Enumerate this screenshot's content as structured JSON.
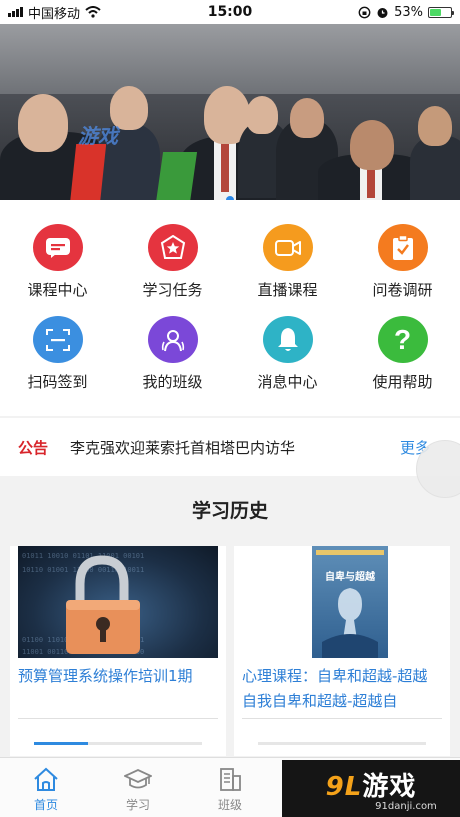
{
  "status_bar": {
    "carrier": "中国移动",
    "time": "15:00",
    "battery": "53%",
    "battery_level": 0.53
  },
  "banner": {
    "watermark": "游戏",
    "dot_color": "#2a88e8"
  },
  "menu": {
    "items": [
      {
        "label": "课程中心",
        "icon": "message-icon",
        "color": "#e5343f"
      },
      {
        "label": "学习任务",
        "icon": "star-badge-icon",
        "color": "#e5343f"
      },
      {
        "label": "直播课程",
        "icon": "video-camera-icon",
        "color": "#f59b1e"
      },
      {
        "label": "问卷调研",
        "icon": "clipboard-check-icon",
        "color": "#f47b1f"
      },
      {
        "label": "扫码签到",
        "icon": "scan-icon",
        "color": "#3b8fe0"
      },
      {
        "label": "我的班级",
        "icon": "group-icon",
        "color": "#7b48d8"
      },
      {
        "label": "消息中心",
        "icon": "bell-icon",
        "color": "#2eb3c6"
      },
      {
        "label": "使用帮助",
        "icon": "help-icon",
        "color": "#3bbb3d"
      }
    ]
  },
  "notice": {
    "tag": "公告",
    "text": "李克强欢迎莱索托首相塔巴内访华",
    "more": "更多"
  },
  "history": {
    "title": "学习历史",
    "courses": [
      {
        "title": "预算管理系统操作培训1期",
        "image": "padlock-image",
        "progress": 0.32
      },
      {
        "title": "心理课程：自卑和超越-超越自我自卑和超越-超越自",
        "image": "book-cover-image",
        "book_title": "自卑与超越",
        "progress": 0.0
      }
    ]
  },
  "tabbar": {
    "tabs": [
      {
        "label": "首页",
        "icon": "home-icon",
        "active": true
      },
      {
        "label": "学习",
        "icon": "graduation-cap-icon",
        "active": false
      },
      {
        "label": "班级",
        "icon": "building-icon",
        "active": false
      }
    ]
  },
  "brand": {
    "name_num": "9L",
    "name_text": "游戏",
    "url": "91danji.com"
  },
  "colors": {
    "accent": "#2e8ae0",
    "notice_red": "#d8252b"
  }
}
